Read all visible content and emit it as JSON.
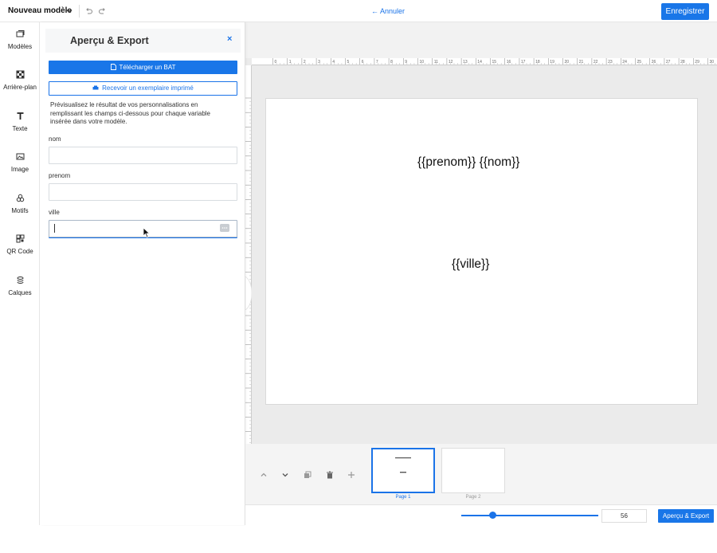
{
  "header": {
    "doc_title": "Nouveau modèle",
    "cancel_label": "Annuler",
    "save_label": "Enregistrer"
  },
  "sidebar": {
    "items": [
      {
        "label": "Modèles",
        "icon": "templates-icon"
      },
      {
        "label": "Arrière-plan",
        "icon": "background-icon"
      },
      {
        "label": "Texte",
        "icon": "text-icon"
      },
      {
        "label": "Image",
        "icon": "image-icon"
      },
      {
        "label": "Motifs",
        "icon": "shapes-icon"
      },
      {
        "label": "QR Code",
        "icon": "qr-code-icon"
      },
      {
        "label": "Calques",
        "icon": "layers-icon"
      }
    ]
  },
  "panel": {
    "title": "Aperçu & Export",
    "close_label": "×",
    "download_bat_label": "Télécharger un BAT",
    "printed_copy_label": "Recevoir un exemplaire imprimé",
    "description": "Prévisualisez le résultat de vos personnalisations en remplissant les champs ci-dessous pour chaque variable insérée dans votre modèle.",
    "fields": [
      {
        "label": "nom",
        "value": ""
      },
      {
        "label": "prenom",
        "value": ""
      },
      {
        "label": "ville",
        "value": ""
      }
    ]
  },
  "canvas": {
    "ruler_marks": [
      "0",
      "1",
      "2",
      "3",
      "4",
      "5",
      "6",
      "7",
      "8",
      "9",
      "10",
      "11",
      "12",
      "13",
      "14",
      "15",
      "16",
      "17",
      "18",
      "19",
      "20",
      "21",
      "22",
      "23",
      "24",
      "25",
      "26",
      "27",
      "28",
      "29",
      "30"
    ],
    "texts": [
      "{{prenom}} {{nom}}",
      "{{ville}}"
    ]
  },
  "pages": [
    {
      "label": "Page 1",
      "active": true
    },
    {
      "label": "Page 2",
      "active": false
    }
  ],
  "zoom": {
    "value": "56",
    "slider_fraction": 0.23
  },
  "footer": {
    "export_label": "Aperçu & Export"
  },
  "colors": {
    "accent": "#1976e8",
    "canvas_bg": "#ebebeb"
  }
}
